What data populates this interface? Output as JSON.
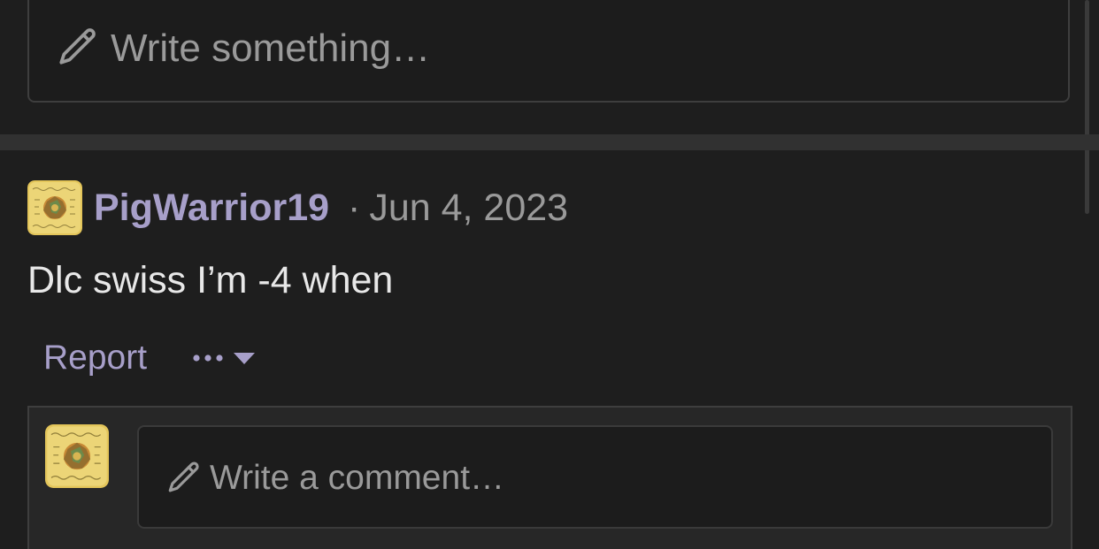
{
  "composer": {
    "placeholder": "Write something…",
    "icon": "pencil-icon"
  },
  "post": {
    "author": "PigWarrior19",
    "separator": "·",
    "date": "Jun 4, 2023",
    "body": "Dlc swiss I’m -4 when",
    "avatar_icon": "user-avatar"
  },
  "actions": {
    "report_label": "Report",
    "more_icon": "more-options-icon"
  },
  "reply": {
    "placeholder": "Write a comment…",
    "icon": "pencil-icon"
  },
  "colors": {
    "background": "#1e1e1e",
    "accent": "#a79fc9",
    "muted_text": "#9a9a9a",
    "body_text": "#e8e8e8",
    "border": "#3e3e3e"
  }
}
